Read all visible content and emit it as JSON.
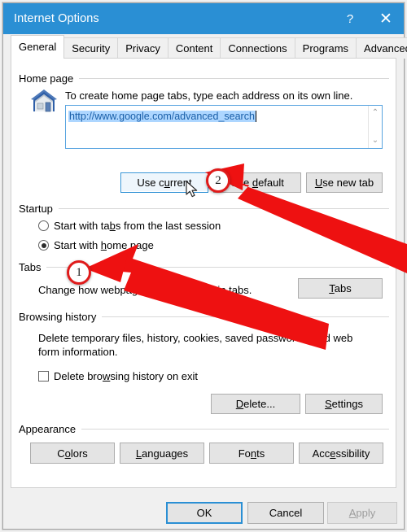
{
  "window": {
    "title": "Internet Options",
    "help_label": "?",
    "close_label": "✕"
  },
  "tabs": [
    {
      "label": "General",
      "active": true
    },
    {
      "label": "Security",
      "active": false
    },
    {
      "label": "Privacy",
      "active": false
    },
    {
      "label": "Content",
      "active": false
    },
    {
      "label": "Connections",
      "active": false
    },
    {
      "label": "Programs",
      "active": false
    },
    {
      "label": "Advanced",
      "active": false
    }
  ],
  "home_page": {
    "group_label": "Home page",
    "description": "To create home page tabs, type each address on its own line.",
    "url_value": "http://www.google.com/advanced_search",
    "url_selected": true,
    "scroll_up_glyph": "⌃",
    "scroll_down_glyph": "⌄",
    "buttons": {
      "use_current": "Use current",
      "use_default": "Use default",
      "use_new_tab": "Use new tab"
    }
  },
  "startup": {
    "group_label": "Startup",
    "options": [
      {
        "label": "Start with tabs from the last session",
        "selected": false
      },
      {
        "label": "Start with home page",
        "selected": true
      }
    ]
  },
  "tabs_section": {
    "group_label": "Tabs",
    "description": "Change how webpages are displayed in tabs.",
    "button": "Tabs"
  },
  "browsing_history": {
    "group_label": "Browsing history",
    "description_line1": "Delete temporary files, history, cookies, saved passwords, and web",
    "description_line2": "form information.",
    "checkbox_label": "Delete browsing history on exit",
    "checkbox_checked": false,
    "delete_button": "Delete...",
    "settings_button": "Settings"
  },
  "appearance": {
    "group_label": "Appearance",
    "buttons": [
      "Colors",
      "Languages",
      "Fonts",
      "Accessibility"
    ]
  },
  "footer": {
    "ok": "OK",
    "cancel": "Cancel",
    "apply": "Apply",
    "apply_disabled": true
  },
  "annotations": {
    "callout_1": "1",
    "callout_2": "2",
    "arrow_color": "#ee1111"
  },
  "colors": {
    "titlebar": "#2a8fd4",
    "dialog_bg": "#f0f0f0",
    "panel_bg": "#ffffff",
    "button_face": "#e4e4e4",
    "accent_blue": "#2a8fd4",
    "selection_blue": "#add6ff"
  }
}
